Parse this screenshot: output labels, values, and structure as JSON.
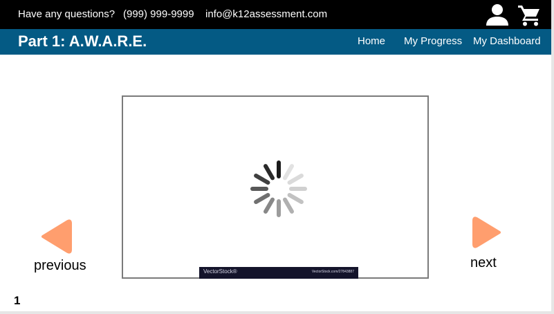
{
  "topbar": {
    "question_text": "Have any questions?",
    "phone": "(999) 999-9999",
    "email": "info@k12assessment.com",
    "icons": [
      "user-icon",
      "cart-icon"
    ]
  },
  "titlebar": {
    "title": "Part 1: A.W.A.R.E.",
    "nav": [
      {
        "label": "Home"
      },
      {
        "label": "My Progress"
      },
      {
        "label": "My Dashboard"
      }
    ]
  },
  "video": {
    "watermark_brand": "VectorStock®",
    "watermark_url": "VectorStock.com/27843887"
  },
  "navigation": {
    "previous_label": "previous",
    "next_label": "next",
    "arrow_color": "#ff9e6e"
  },
  "page_number": "1",
  "colors": {
    "topbar": "#000000",
    "titlebar": "#045a84"
  }
}
